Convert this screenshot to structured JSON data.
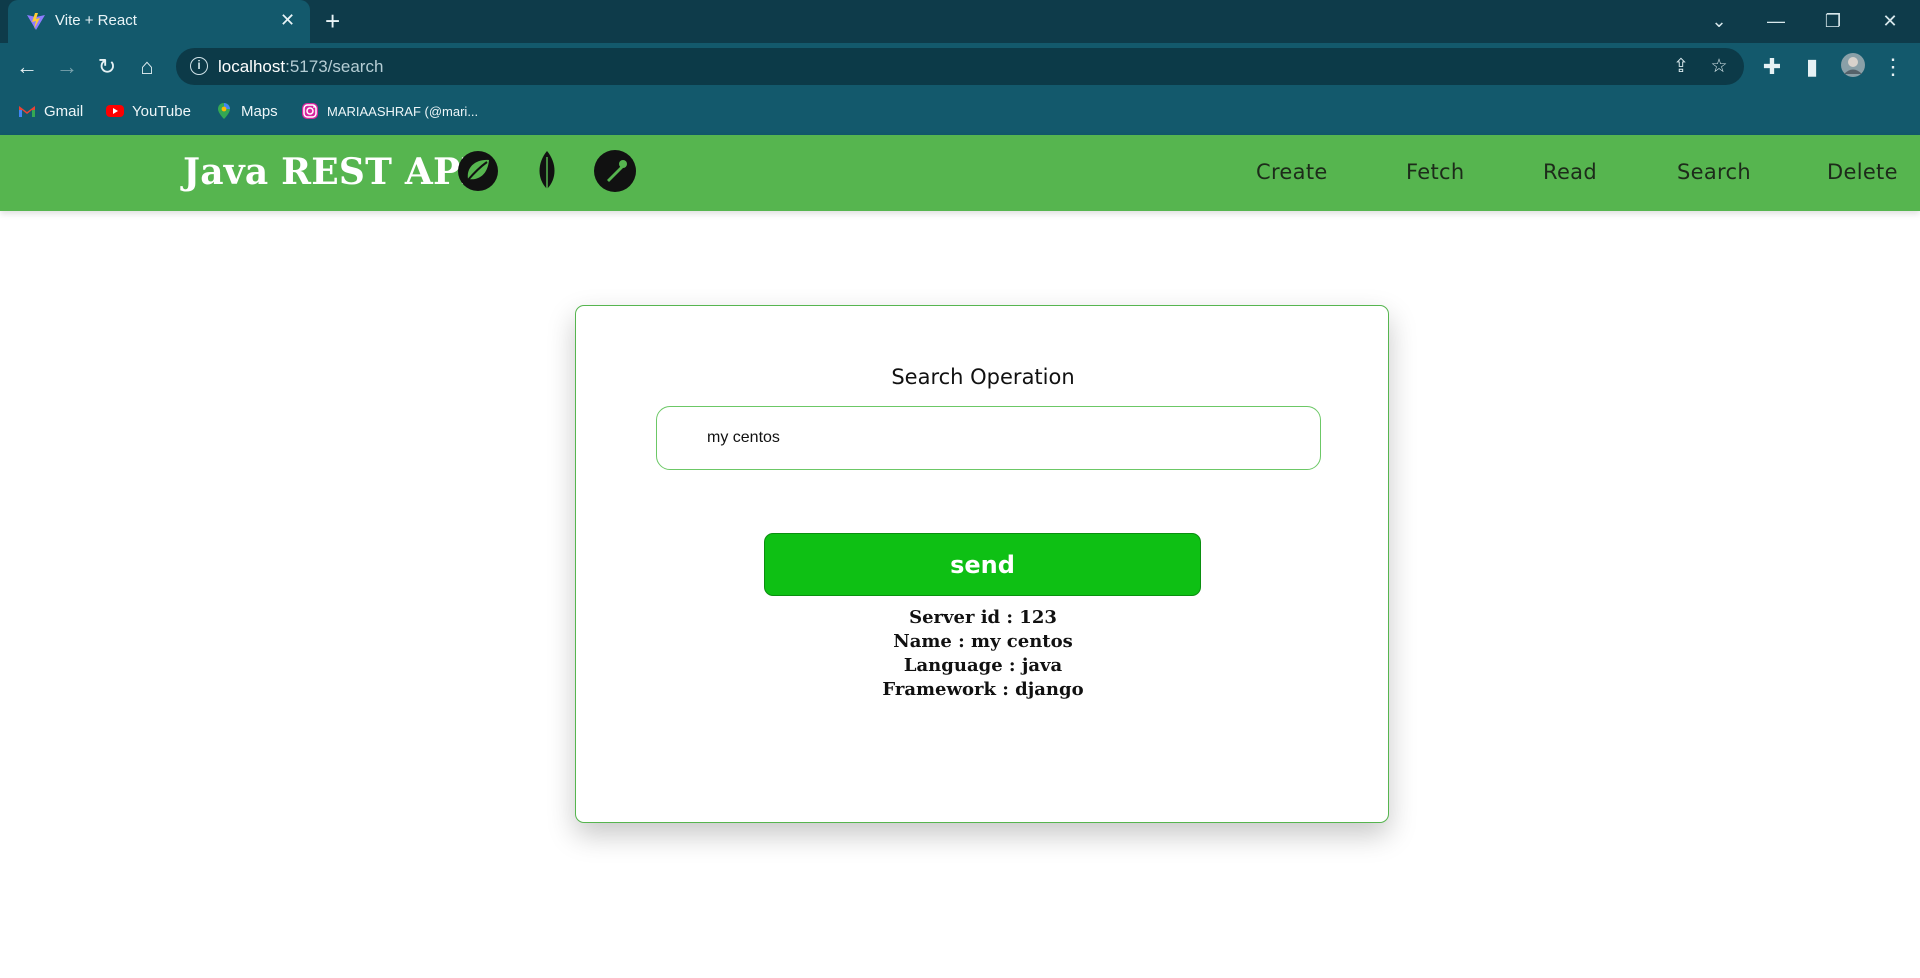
{
  "browser": {
    "tab_title": "Vite + React",
    "url_host": "localhost",
    "url_path": ":5173/search",
    "bookmarks": [
      {
        "label": "Gmail",
        "icon": "gmail-icon"
      },
      {
        "label": "YouTube",
        "icon": "youtube-icon"
      },
      {
        "label": "Maps",
        "icon": "maps-icon"
      },
      {
        "label": "MARIAASHRAF (@mari...",
        "icon": "instagram-icon"
      }
    ]
  },
  "header": {
    "brand": "Java REST API",
    "tech_icons": [
      "spring-icon",
      "mongodb-leaf-icon",
      "postman-icon"
    ],
    "nav": [
      "Create",
      "Fetch",
      "Read",
      "Search",
      "Delete"
    ]
  },
  "search": {
    "title": "Search Operation",
    "input_value": "my centos",
    "button_label": "send",
    "result": {
      "server_id": "Server id : 123",
      "name": "Name : my centos",
      "language": "Language : java",
      "framework": "Framework : django"
    }
  },
  "colors": {
    "header_bg": "#56b54f",
    "button_bg": "#0ec014",
    "browser_frame": "#13596c"
  }
}
